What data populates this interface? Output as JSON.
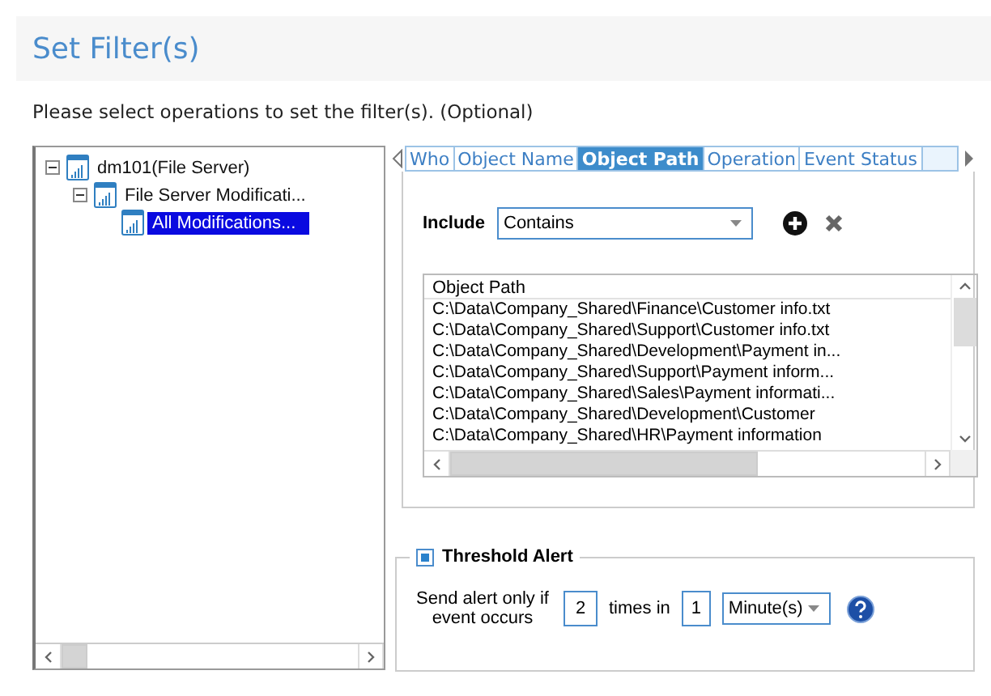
{
  "title": "Set Filter(s)",
  "instruction": "Please select operations to set the filter(s). (Optional)",
  "tree": [
    {
      "label": "dm101(File Server)",
      "expanded": true,
      "selected": false,
      "children": [
        {
          "label": "File Server Modificati...",
          "expanded": true,
          "selected": false,
          "children": [
            {
              "label": "All Modifications...",
              "selected": true
            }
          ]
        }
      ]
    }
  ],
  "tabs": [
    {
      "label": "Who",
      "selected": false
    },
    {
      "label": "Object Name",
      "selected": false
    },
    {
      "label": "Object Path",
      "selected": true
    },
    {
      "label": "Operation",
      "selected": false
    },
    {
      "label": "Event Status",
      "selected": false
    }
  ],
  "include": {
    "label": "Include",
    "value": "Contains"
  },
  "list": {
    "header": "Object Path",
    "rows": [
      "C:\\Data\\Company_Shared\\Finance\\Customer info.txt",
      "C:\\Data\\Company_Shared\\Support\\Customer info.txt",
      "C:\\Data\\Company_Shared\\Development\\Payment in...",
      "C:\\Data\\Company_Shared\\Support\\Payment inform...",
      "C:\\Data\\Company_Shared\\Sales\\Payment informati...",
      "C:\\Data\\Company_Shared\\Development\\Customer",
      "C:\\Data\\Company_Shared\\HR\\Payment information"
    ]
  },
  "threshold": {
    "title": "Threshold Alert",
    "checked": true,
    "label": "Send alert only if event occurs",
    "count": "2",
    "between": "times in",
    "period": "1",
    "unit": "Minute(s)"
  }
}
